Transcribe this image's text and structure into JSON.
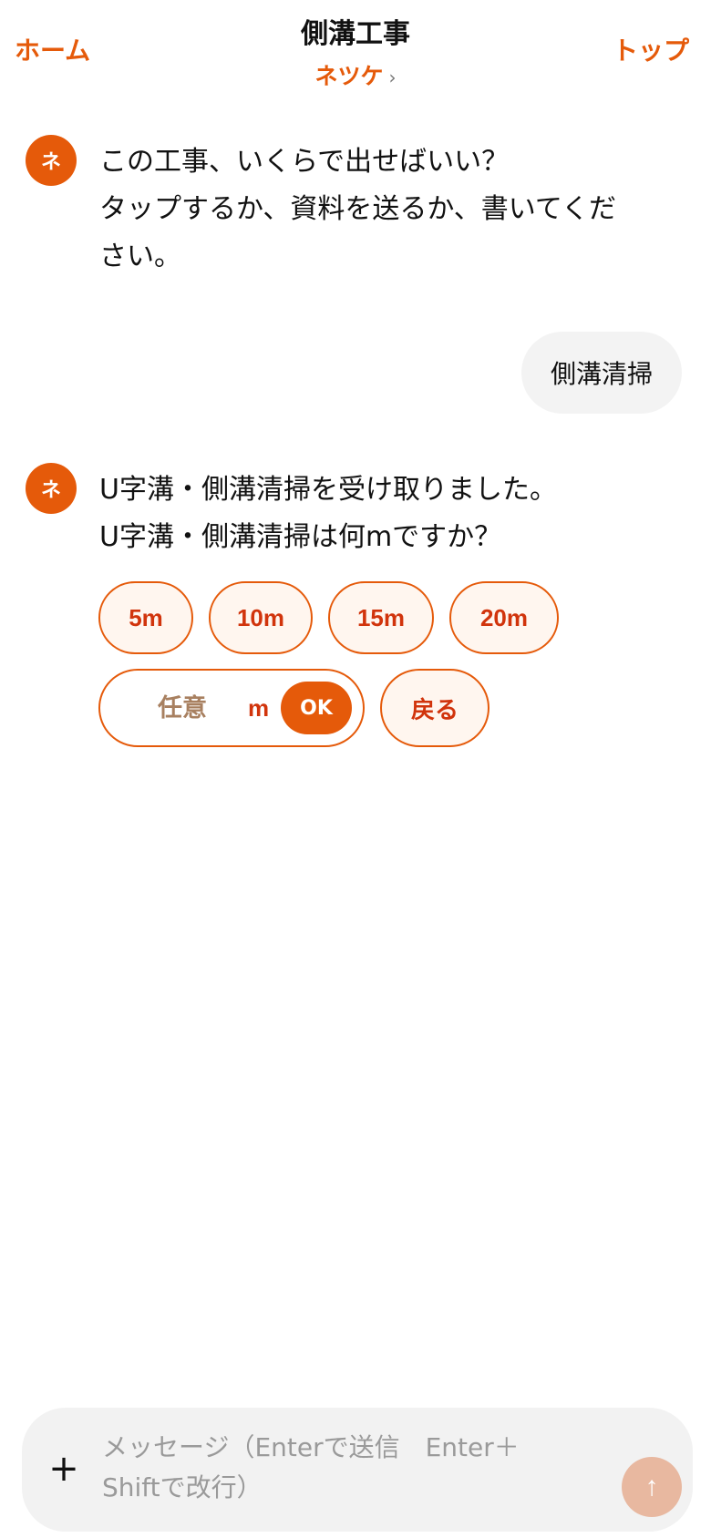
{
  "header": {
    "home_label": "ホーム",
    "title": "側溝工事",
    "subtitle": "ネツケ",
    "top_label": "トップ"
  },
  "messages": [
    {
      "role": "bot",
      "avatar": "ネ",
      "lines": [
        "この工事、いくらで出せばいい？",
        "タップするか、資料を送るか、書いてくだ",
        "さい。"
      ]
    },
    {
      "role": "user",
      "text": "側溝清掃"
    },
    {
      "role": "bot",
      "avatar": "ネ",
      "lines": [
        "U字溝・側溝清掃を受け取りました。",
        "U字溝・側溝清掃は何mですか？"
      ]
    }
  ],
  "options": {
    "chips": [
      "5m",
      "10m",
      "15m",
      "20m"
    ],
    "custom": {
      "placeholder": "任意",
      "unit": "m",
      "ok_label": "OK"
    },
    "back_label": "戻る"
  },
  "composer": {
    "plus_icon": "plus-icon",
    "placeholder": "メッセージ（Enterで送信　Enter＋Shiftで改行）",
    "send_icon": "arrow-up-icon"
  },
  "colors": {
    "accent": "#e55a0a",
    "chip_text": "#d1340c",
    "chip_bg": "#fff6ef",
    "bubble_bg": "#f3f3f3",
    "send_disabled": "#e8b8a0"
  }
}
